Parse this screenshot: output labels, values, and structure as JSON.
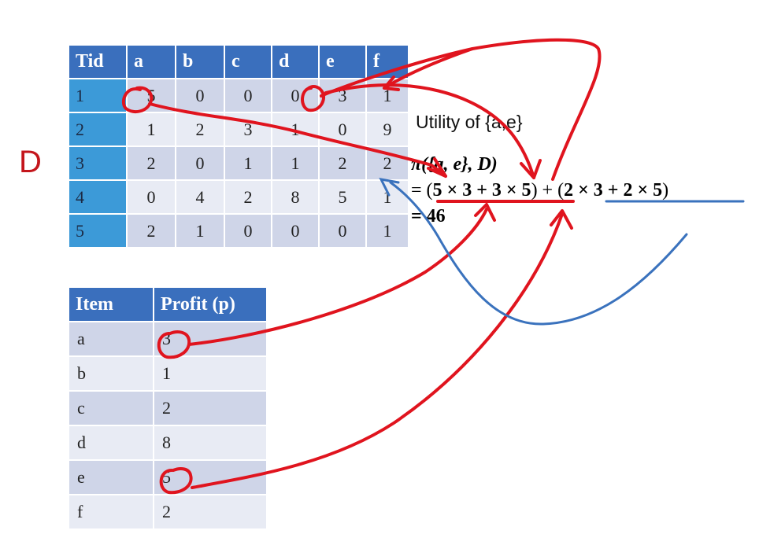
{
  "d_label": "D",
  "utility_title": "Utility of {a,e}",
  "formula": {
    "line1": "π({a, e}, D)",
    "line2_prefix": "= (",
    "line2_term1": "5 × 3 + 3 × 5",
    "line2_mid": ") + (",
    "line2_term2": "2 × 3 + 2 × 5",
    "line2_suffix": ")",
    "line3": "= 46"
  },
  "transaction_table": {
    "headers": [
      "Tid",
      "a",
      "b",
      "c",
      "d",
      "e",
      "f"
    ],
    "rows": [
      [
        "1",
        "5",
        "0",
        "0",
        "0",
        "3",
        "1"
      ],
      [
        "2",
        "1",
        "2",
        "3",
        "1",
        "0",
        "9"
      ],
      [
        "3",
        "2",
        "0",
        "1",
        "1",
        "2",
        "2"
      ],
      [
        "4",
        "0",
        "4",
        "2",
        "8",
        "5",
        "1"
      ],
      [
        "5",
        "2",
        "1",
        "0",
        "0",
        "0",
        "1"
      ]
    ]
  },
  "profit_table": {
    "headers": [
      "Item",
      "Profit (p)"
    ],
    "rows": [
      [
        "a",
        "3"
      ],
      [
        "b",
        "1"
      ],
      [
        "c",
        "2"
      ],
      [
        "d",
        "8"
      ],
      [
        "e",
        "5"
      ],
      [
        "f",
        "2"
      ]
    ]
  },
  "colors": {
    "header_blue": "#3a6fbd",
    "tid_blue": "#3c9ad8",
    "cell_dark": "#cfd5e8",
    "cell_light": "#e8ebf4",
    "annotation_red": "#e0141e",
    "annotation_blue": "#3a72bd"
  }
}
